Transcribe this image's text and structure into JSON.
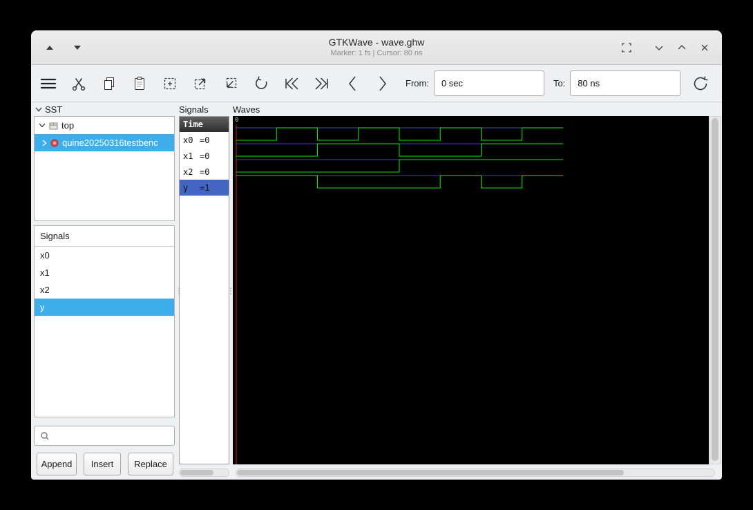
{
  "titlebar": {
    "title": "GTKWave - wave.ghw",
    "status": "Marker: 1 fs  |  Cursor: 80 ns"
  },
  "toolbar": {
    "from_label": "From:",
    "from_value": "0 sec",
    "to_label": "To:",
    "to_value": "80 ns"
  },
  "sst_panel": {
    "header": "SST",
    "tree_items": [
      {
        "label": "top",
        "expanded": true,
        "selected": false
      },
      {
        "label": "quine20250316testbenc",
        "expanded": false,
        "selected": true
      }
    ],
    "signals_frame": {
      "label": "Signals",
      "items": [
        "x0",
        "x1",
        "x2",
        "y"
      ],
      "selected": "y"
    },
    "buttons": {
      "append": "Append",
      "insert": "Insert",
      "replace": "Replace"
    }
  },
  "signals_panel": {
    "label": "Signals",
    "time_header": "Time",
    "rows": [
      {
        "name": "x0",
        "value": "=0",
        "selected": false
      },
      {
        "name": "x1",
        "value": "=0",
        "selected": false
      },
      {
        "name": "x2",
        "value": "=0",
        "selected": false
      },
      {
        "name": "y",
        "value": "=1",
        "selected": true
      }
    ]
  },
  "waves_panel": {
    "label": "Waves",
    "timeline_origin": "0"
  },
  "chart_data": {
    "type": "digital-waveform",
    "time_unit": "ns",
    "t_start": 0,
    "t_end": 80,
    "marker_time": 0,
    "cursor_time": 80,
    "signals": [
      {
        "name": "x0",
        "wave": [
          [
            0,
            0
          ],
          [
            10,
            1
          ],
          [
            20,
            0
          ],
          [
            30,
            1
          ],
          [
            40,
            0
          ],
          [
            50,
            1
          ],
          [
            60,
            0
          ],
          [
            70,
            1
          ]
        ]
      },
      {
        "name": "x1",
        "wave": [
          [
            0,
            0
          ],
          [
            20,
            1
          ],
          [
            40,
            0
          ],
          [
            60,
            1
          ]
        ]
      },
      {
        "name": "x2",
        "wave": [
          [
            0,
            0
          ],
          [
            40,
            1
          ]
        ]
      },
      {
        "name": "y",
        "wave": [
          [
            0,
            1
          ],
          [
            20,
            0
          ],
          [
            50,
            1
          ],
          [
            60,
            0
          ],
          [
            70,
            1
          ]
        ]
      }
    ]
  },
  "colors": {
    "selection": "#3daee9",
    "signal_row_selected": "#4365c2",
    "wave_green": "#00f000",
    "wave_blue": "#4040c8",
    "marker_red": "#cc1a1a",
    "canvas": "#000000"
  }
}
